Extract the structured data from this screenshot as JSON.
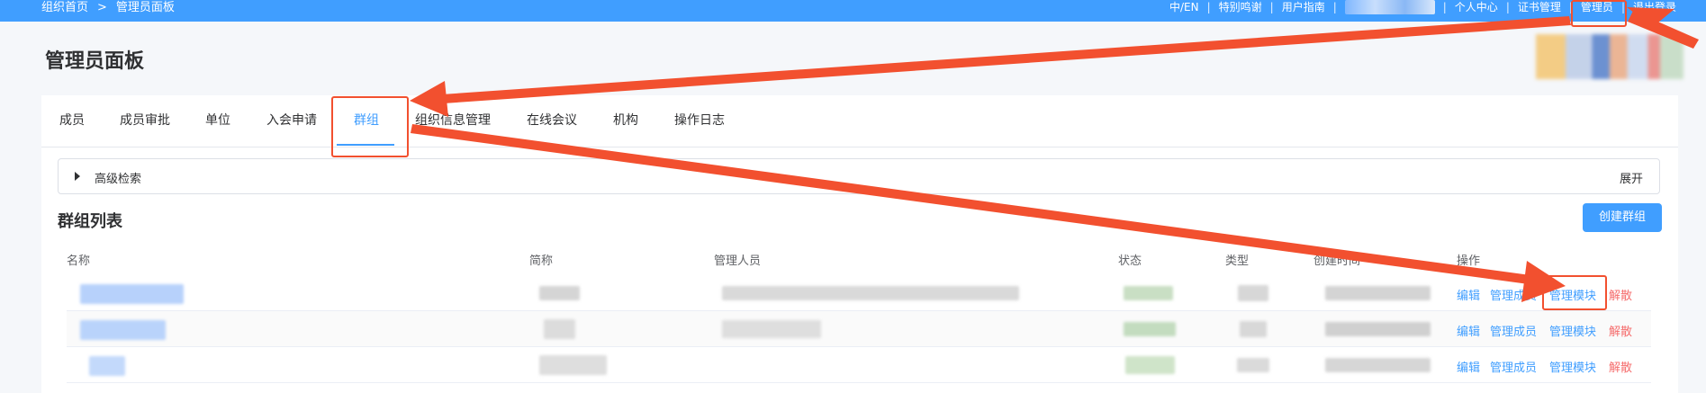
{
  "breadcrumb": {
    "home": "组织首页",
    "separator": ">",
    "current": "管理员面板"
  },
  "topnav": {
    "items": [
      "中/EN",
      "特别鸣谢",
      "用户指南",
      "个人中心",
      "证书管理",
      "管理员",
      "退出登录"
    ],
    "separator": "|"
  },
  "page": {
    "title": "管理员面板"
  },
  "tabs": [
    "成员",
    "成员审批",
    "单位",
    "入会申请",
    "群组",
    "组织信息管理",
    "在线会议",
    "机构",
    "操作日志"
  ],
  "active_tab": "群组",
  "search": {
    "label": "高级检索",
    "expand": "展开"
  },
  "list": {
    "title": "群组列表",
    "create_button": "创建群组"
  },
  "table": {
    "headers": [
      "名称",
      "简称",
      "管理人员",
      "状态",
      "类型",
      "创建时间",
      "操作"
    ],
    "actions": {
      "edit": "编辑",
      "members": "管理成员",
      "modules": "管理模块",
      "dissolve": "解散"
    }
  },
  "colors": {
    "accent": "#409eff",
    "danger": "#f56c6c",
    "annotation": "#f2502f"
  },
  "icons": {
    "breadcrumb_separator": "chevron-right-icon",
    "search_toggle": "caret-right-icon"
  }
}
